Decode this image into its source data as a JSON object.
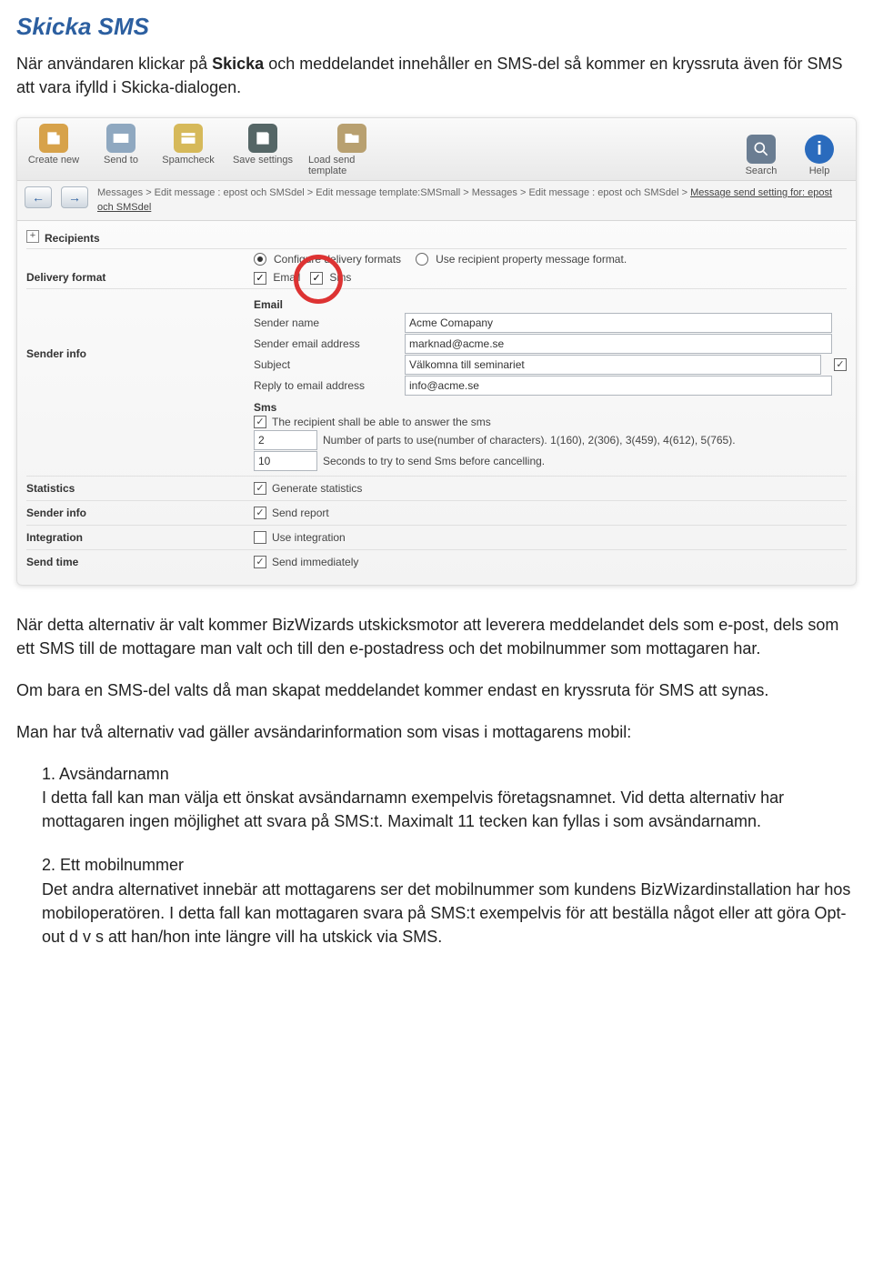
{
  "title": "Skicka SMS",
  "intro_pre": "När användaren klickar på ",
  "intro_bold": "Skicka",
  "intro_post": " och meddelandet innehåller en SMS-del så kommer en kryssruta även för SMS att vara ifylld i Skicka-dialogen.",
  "toolbar": {
    "create": "Create new",
    "send": "Send to",
    "spam": "Spamcheck",
    "save": "Save settings",
    "load": "Load send template",
    "search": "Search",
    "help": "Help"
  },
  "breadcrumb": {
    "part1": "Messages > Edit message : epost och SMSdel > Edit message template:SMSmall > Messages > Edit message : epost och SMSdel > ",
    "current": "Message send setting for: epost och SMSdel"
  },
  "rows": {
    "recipients": "Recipients",
    "delivery": "Delivery format",
    "sender": "Sender info",
    "statistics": "Statistics",
    "sender2": "Sender info",
    "integration": "Integration",
    "sendtime": "Send time"
  },
  "delivery": {
    "configure": "Configure delivery formats",
    "userecipient": "Use recipient property message format.",
    "email": "Email",
    "sms": "Sms"
  },
  "email": {
    "heading": "Email",
    "sender_name_label": "Sender name",
    "sender_name_value": "Acme Comapany",
    "sender_email_label": "Sender email address",
    "sender_email_value": "marknad@acme.se",
    "subject_label": "Subject",
    "subject_value": "Välkomna till seminariet",
    "reply_label": "Reply to email address",
    "reply_value": "info@acme.se"
  },
  "sms": {
    "heading": "Sms",
    "answer": "The recipient shall be able to answer the sms",
    "parts_value": "2",
    "parts_label": "Number of parts to use(number of characters). 1(160), 2(306), 3(459), 4(612), 5(765).",
    "seconds_value": "10",
    "seconds_label": "Seconds to try to send Sms before cancelling."
  },
  "opts": {
    "stats": "Generate statistics",
    "report": "Send report",
    "integration": "Use integration",
    "immediate": "Send immediately"
  },
  "para2": "När detta alternativ är valt kommer BizWizards utskicksmotor att leverera meddelandet dels som e-post, dels som ett SMS till de mottagare man valt och till den e-postadress och det mobilnummer som mottagaren har.",
  "para3": "Om bara en SMS-del valts då man skapat meddelandet kommer endast en kryssruta för SMS att synas.",
  "para4": "Man har två alternativ vad gäller avsändarinformation som visas i mottagarens mobil:",
  "list": {
    "item1_title": "1. Avsändarnamn",
    "item1_body": "I detta fall kan man välja ett önskat avsändarnamn exempelvis företagsnamnet. Vid detta alternativ har mottagaren ingen möjlighet att svara på SMS:t. Maximalt 11 tecken kan fyllas i som avsändarnamn.",
    "item2_title": "2. Ett mobilnummer",
    "item2_body": "Det andra alternativet innebär att mottagarens ser det mobilnummer som kundens BizWizardinstallation har hos mobiloperatören. I detta fall kan mottagaren svara på SMS:t exempelvis för att beställa något eller att göra Opt-out d v s att han/hon inte längre vill ha utskick via SMS."
  }
}
